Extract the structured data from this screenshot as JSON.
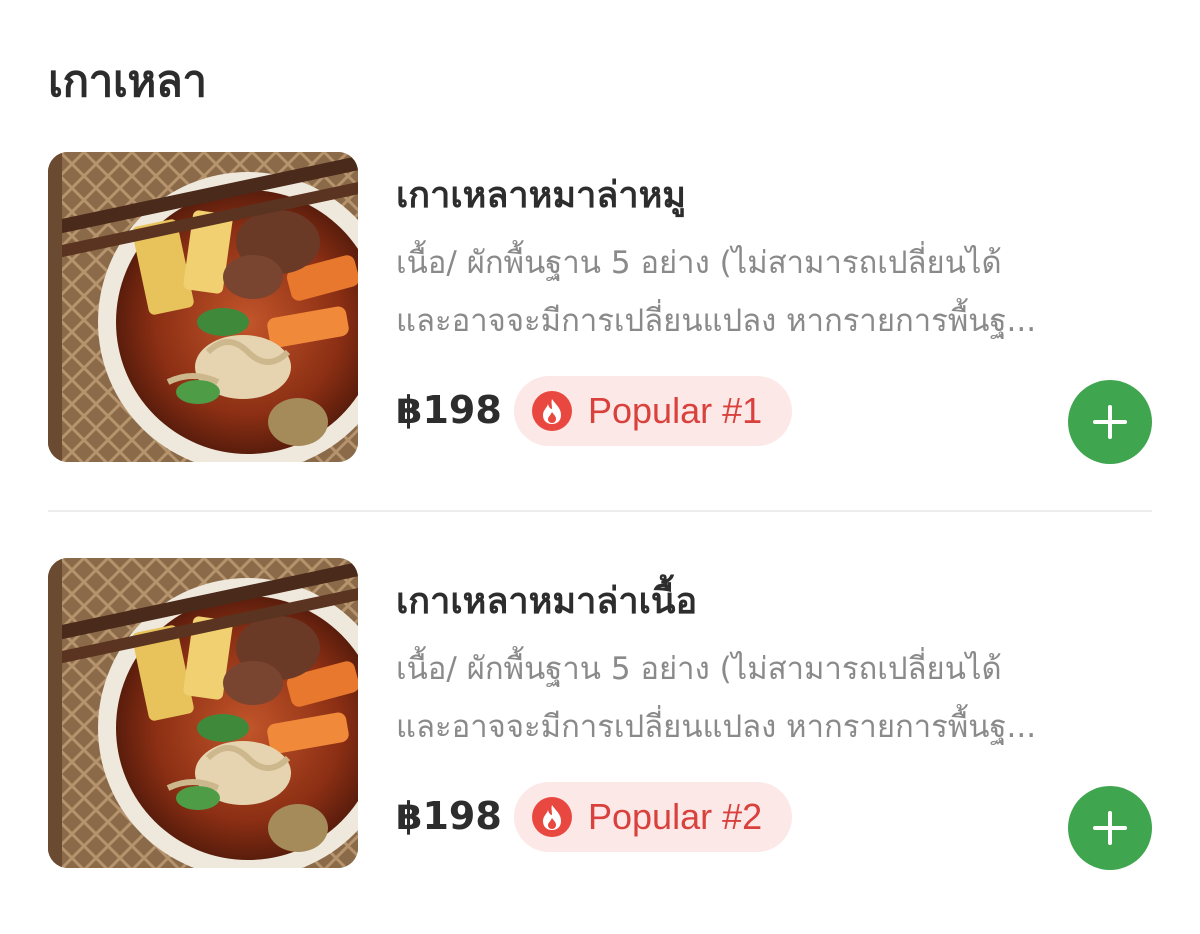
{
  "section": {
    "title": "เกาเหลา"
  },
  "items": [
    {
      "name": "เกาเหลาหมาล่าหมู",
      "description_line1": "เนื้อ/ ผักพื้นฐาน 5 อย่าง (ไม่สามารถเปลี่ยนได้",
      "description_line2": "และอาจจะมีการเปลี่ยนแปลง หากรายการพื้นฐ...",
      "price": "฿198",
      "badge": "Popular #1",
      "image_icon": "food-photo-icon"
    },
    {
      "name": "เกาเหลาหมาล่าเนื้อ",
      "description_line1": "เนื้อ/ ผักพื้นฐาน 5 อย่าง (ไม่สามารถเปลี่ยนได้",
      "description_line2": "และอาจจะมีการเปลี่ยนแปลง หากรายการพื้นฐ...",
      "price": "฿198",
      "badge": "Popular #2",
      "image_icon": "food-photo-icon"
    }
  ],
  "colors": {
    "accent_green": "#3fa64f",
    "badge_bg": "#fde8e8",
    "badge_text": "#d9413d",
    "text_primary": "#2d2d2d",
    "text_secondary": "#8a8a8a"
  },
  "icons": {
    "badge_icon": "flame-icon",
    "add_icon": "plus-icon"
  }
}
